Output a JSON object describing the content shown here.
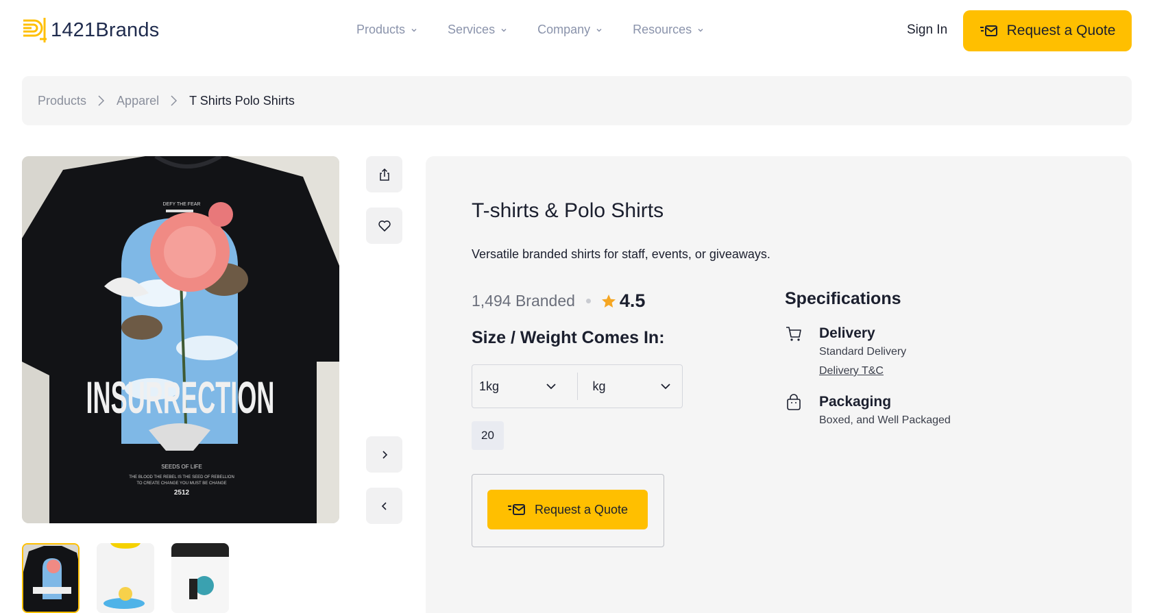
{
  "header": {
    "logo_text": "1421Brands",
    "nav": [
      {
        "label": "Products"
      },
      {
        "label": "Services"
      },
      {
        "label": "Company"
      },
      {
        "label": "Resources"
      }
    ],
    "sign_in": "Sign In",
    "quote_label": "Request a Quote"
  },
  "breadcrumb": {
    "items": [
      "Products",
      "Apparel",
      "T Shirts Polo Shirts"
    ]
  },
  "product": {
    "title": "T-shirts & Polo Shirts",
    "description": "Versatile branded shirts for staff, events, or giveaways.",
    "branded_count": "1,494 Branded",
    "rating": "4.5",
    "size_heading": "Size / Weight Comes In:",
    "size_value": "1kg",
    "unit_value": "kg",
    "quantity": "20",
    "quote_label": "Request a Quote"
  },
  "specifications": {
    "heading": "Specifications",
    "delivery": {
      "title": "Delivery",
      "subtitle": "Standard Delivery",
      "link": "Delivery T&C"
    },
    "packaging": {
      "title": "Packaging",
      "subtitle": "Boxed, and Well Packaged"
    }
  },
  "gallery": {
    "shirt_text": {
      "top": "DEFY THE FEAR",
      "main": "INSURRECTION",
      "sub": "SEEDS OF LIFE",
      "line1": "THE BLOOD THE REBEL IS THE SEED OF REBELLION",
      "line2": "TO CREATE CHANGE YOU MUST BE CHANGE",
      "num": "2512"
    }
  },
  "colors": {
    "accent": "#ffbf00",
    "panel_bg": "#f5f5f5",
    "nav_text": "#8a93ab"
  }
}
